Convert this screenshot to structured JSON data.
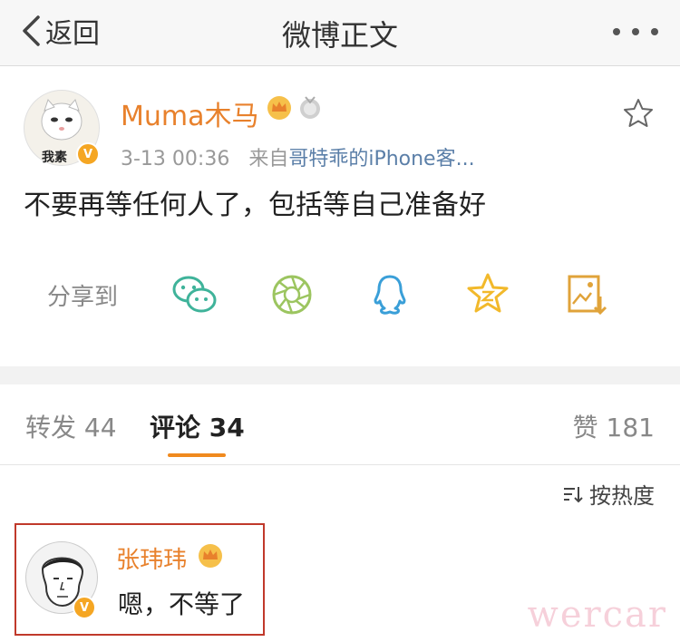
{
  "nav": {
    "back_label": "返回",
    "title": "微博正文"
  },
  "post": {
    "username": "Muma木马",
    "timestamp": "3-13 00:36",
    "source_prefix": "来自",
    "source_name": "哥特乖的iPhone客...",
    "avatar_text": "我素",
    "content": "不要再等任何人了，包括等自己准备好",
    "share_label": "分享到",
    "share_targets": [
      "wechat",
      "moments",
      "qq",
      "qzone",
      "save-image"
    ]
  },
  "tabs": {
    "repost": "转发 44",
    "comments": "评论 34",
    "likes": "赞 181"
  },
  "comments": {
    "sort_label": "按热度",
    "items": [
      {
        "name": "张玮玮",
        "text": "嗯，不等了"
      }
    ]
  },
  "watermark": "wercar",
  "colors": {
    "accent": "#f08a1e",
    "username": "#e8812c",
    "link": "#5b7fa8",
    "highlight_border": "#c0392b"
  }
}
